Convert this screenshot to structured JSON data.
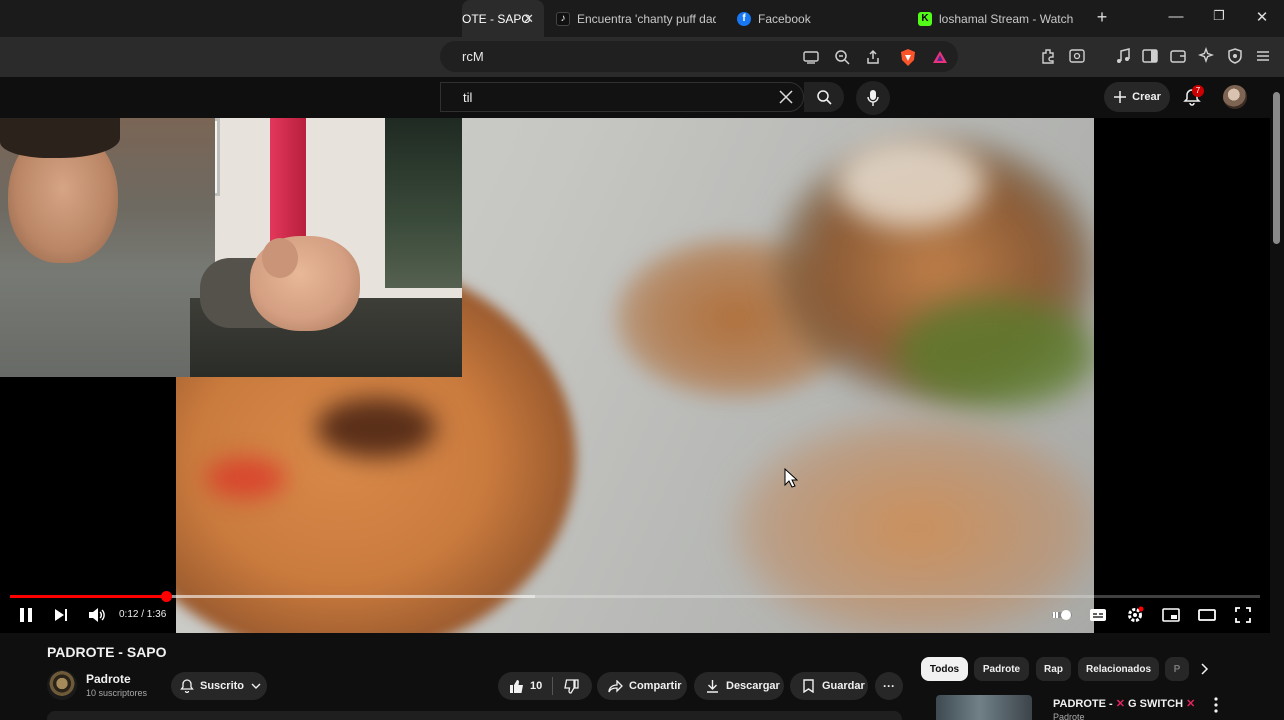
{
  "browser": {
    "tabs": [
      {
        "label": "OTE - SAPO",
        "active": true
      },
      {
        "label": "Encuentra 'chanty puff dad",
        "active": false
      },
      {
        "label": "Facebook",
        "active": false
      },
      {
        "label": "loshamal Stream - Watch l",
        "active": false
      }
    ],
    "close_glyph": "✕",
    "new_tab_glyph": "+",
    "window_controls": {
      "minimize": "—",
      "restore": "❐",
      "close": "✕"
    },
    "address": "rcM",
    "colors": {
      "tiktok": "#000000",
      "facebook": "#1877f2",
      "kick": "#53fc18",
      "brave": "#fb542b"
    }
  },
  "youtube": {
    "search_value": "til",
    "create_label": "Crear",
    "notification_count": "7",
    "accent": "#ff0000"
  },
  "player": {
    "time": "0:12 / 1:36",
    "progress": 0.125,
    "buffered": 0.42
  },
  "video": {
    "title": "PADROTE - SAPO",
    "channel": "Padrote",
    "subscribers": "10 suscriptores",
    "subscribe_label": "Suscrito",
    "likes": "10",
    "share_label": "Compartir",
    "download_label": "Descargar",
    "save_label": "Guardar",
    "more_glyph": "···"
  },
  "chips": [
    "Todos",
    "Padrote",
    "Rap",
    "Relacionados",
    "P"
  ],
  "recommendation": {
    "title_parts": [
      "PADROTE - ",
      "G SWITCH"
    ],
    "mark_glyph": "✕",
    "mark_color": "#e0245e",
    "channel": "Padrote"
  }
}
